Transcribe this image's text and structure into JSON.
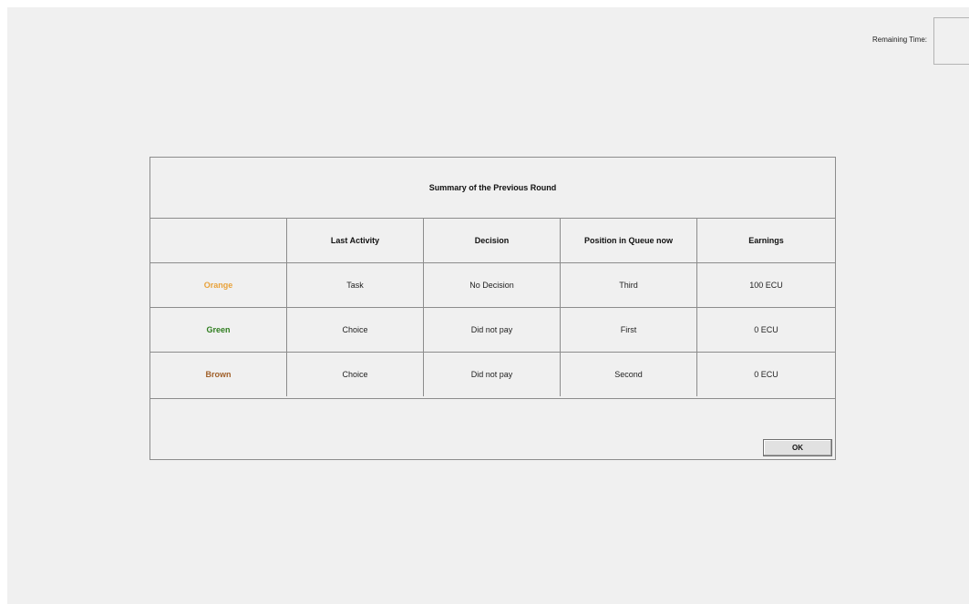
{
  "timer": {
    "label": "Remaining Time:",
    "value": ""
  },
  "dialog": {
    "title": "Summary of the Previous Round",
    "columns": [
      "",
      "Last Activity",
      "Decision",
      "Position in Queue now",
      "Earnings"
    ],
    "rows": [
      {
        "player": "Orange",
        "color": "#e8a23a",
        "last_activity": "Task",
        "decision": "No Decision",
        "position": "Third",
        "earnings": "100 ECU"
      },
      {
        "player": "Green",
        "color": "#2e7d1e",
        "last_activity": "Choice",
        "decision": "Did not pay",
        "position": "First",
        "earnings": "0 ECU"
      },
      {
        "player": "Brown",
        "color": "#a0602a",
        "last_activity": "Choice",
        "decision": "Did not pay",
        "position": "Second",
        "earnings": "0 ECU"
      }
    ],
    "ok_label": "OK"
  }
}
